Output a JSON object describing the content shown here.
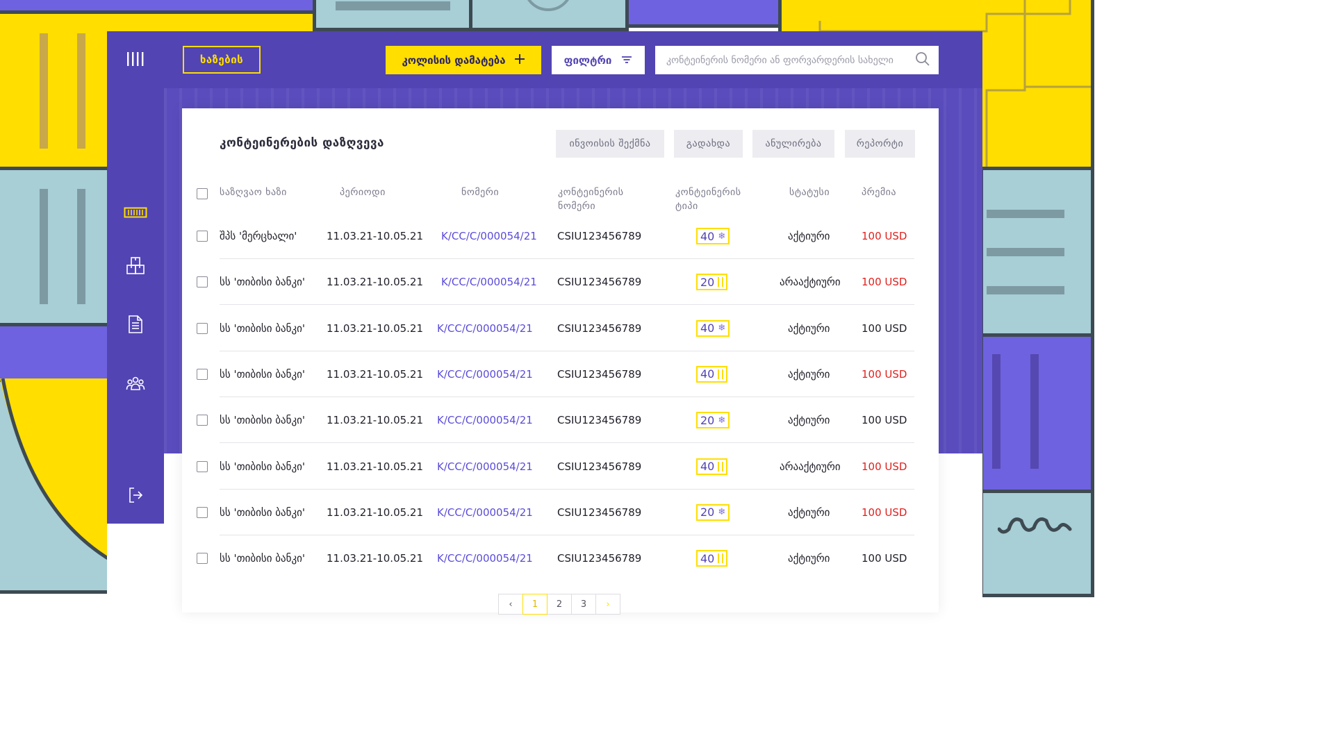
{
  "colors": {
    "brand_purple": "#5244b3",
    "accent_yellow": "#ffde00",
    "link": "#5a4cd8",
    "alert_red": "#e0201c"
  },
  "sidebar": {
    "items": [
      {
        "icon": "menu-bars-icon"
      },
      {
        "icon": "container-icon",
        "active": true
      },
      {
        "icon": "boxes-icon"
      },
      {
        "icon": "document-icon"
      },
      {
        "icon": "users-icon"
      },
      {
        "icon": "logout-icon"
      }
    ]
  },
  "topbar": {
    "bases_button": "ხაზების",
    "add_policy_button": "კოლისის დამატება",
    "filter_button": "ფილტრი",
    "search_placeholder": "კონტეინერის ნომერი ან ფორვარდერის სახელი"
  },
  "card": {
    "title": "კონტეინერების დაზღვევა",
    "actions": {
      "invoice": "ინვოისის შექმნა",
      "payment": "გადახდა",
      "cancel": "ანულირება",
      "report": "რეპორტი"
    },
    "columns": {
      "insurer": "საზღვაო ხაზი",
      "period": "პერიოდი",
      "number": "ნომერი",
      "container_number": "კონტეინერის ნომერი",
      "container_type": "კონტეინერის ტიპი",
      "status": "სტატუსი",
      "premium": "პრემია"
    },
    "rows": [
      {
        "insurer": "შპს 'მერცხალი'",
        "period": "11.03.21-10.05.21",
        "number": "K/CC/C/000054/21",
        "container": "CSIU123456789",
        "size": "40",
        "type": "reefer",
        "status": "აქტიური",
        "premium": "100 USD",
        "premium_red": true
      },
      {
        "insurer": "სს 'თიბისი ბანკი'",
        "period": "11.03.21-10.05.21",
        "number": "K/CC/C/000054/21",
        "container": "CSIU123456789",
        "size": "20",
        "type": "dry",
        "status": "არააქტიური",
        "premium": "100 USD",
        "premium_red": true
      },
      {
        "insurer": "სს 'თიბისი ბანკი'",
        "period": "11.03.21-10.05.21",
        "number": "K/CC/C/000054/21",
        "container": "CSIU123456789",
        "size": "40",
        "type": "reefer",
        "status": "აქტიური",
        "premium": "100 USD",
        "premium_red": false
      },
      {
        "insurer": "სს 'თიბისი ბანკი'",
        "period": "11.03.21-10.05.21",
        "number": "K/CC/C/000054/21",
        "container": "CSIU123456789",
        "size": "40",
        "type": "dry",
        "status": "აქტიური",
        "premium": "100 USD",
        "premium_red": true
      },
      {
        "insurer": "სს 'თიბისი ბანკი'",
        "period": "11.03.21-10.05.21",
        "number": "K/CC/C/000054/21",
        "container": "CSIU123456789",
        "size": "20",
        "type": "reefer",
        "status": "აქტიური",
        "premium": "100 USD",
        "premium_red": false
      },
      {
        "insurer": "სს 'თიბისი ბანკი'",
        "period": "11.03.21-10.05.21",
        "number": "K/CC/C/000054/21",
        "container": "CSIU123456789",
        "size": "40",
        "type": "dry",
        "status": "არააქტიური",
        "premium": "100 USD",
        "premium_red": true
      },
      {
        "insurer": "სს 'თიბისი ბანკი'",
        "period": "11.03.21-10.05.21",
        "number": "K/CC/C/000054/21",
        "container": "CSIU123456789",
        "size": "20",
        "type": "reefer",
        "status": "აქტიური",
        "premium": "100 USD",
        "premium_red": true
      },
      {
        "insurer": "სს 'თიბისი ბანკი'",
        "period": "11.03.21-10.05.21",
        "number": "K/CC/C/000054/21",
        "container": "CSIU123456789",
        "size": "40",
        "type": "dry",
        "status": "აქტიური",
        "premium": "100 USD",
        "premium_red": false
      }
    ]
  },
  "pagination": {
    "prev": "‹",
    "pages": [
      "1",
      "2",
      "3"
    ],
    "current": "1",
    "next": "›"
  }
}
